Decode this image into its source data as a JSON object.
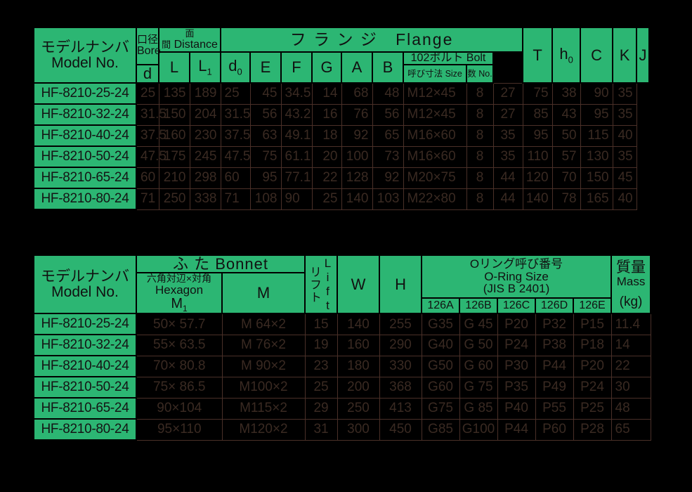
{
  "page": {
    "background": "#000000",
    "header_fill": "#2cb673",
    "header_text": "#111111",
    "data_text": "#3a2a22"
  },
  "table1": {
    "name": "flange-dimension-table",
    "model_header": {
      "line1": "モデルナンバ",
      "line2": "Model No."
    },
    "groups": {
      "bore": {
        "jp": "口径",
        "en": "Bore"
      },
      "distance": {
        "jp": "面間",
        "en": "Distance"
      },
      "flange": {
        "jp": "フ ラ ン ジ",
        "en": "Flange"
      },
      "bolt": {
        "label": "102ボルト Bolt"
      }
    },
    "columns": [
      {
        "key": "d",
        "label": "d"
      },
      {
        "key": "L",
        "label": "L"
      },
      {
        "key": "L1",
        "label": "L",
        "sub": "1"
      },
      {
        "key": "d0",
        "label": "d",
        "sub": "0"
      },
      {
        "key": "E",
        "label": "E"
      },
      {
        "key": "F",
        "label": "F"
      },
      {
        "key": "G",
        "label": "G"
      },
      {
        "key": "A",
        "label": "A"
      },
      {
        "key": "B",
        "label": "B"
      },
      {
        "key": "bolt_size",
        "label": "呼び寸法 Size"
      },
      {
        "key": "bolt_no",
        "label": "数 No."
      },
      {
        "key": "T",
        "label": "T"
      },
      {
        "key": "h0",
        "label": "h",
        "sub": "0"
      },
      {
        "key": "C",
        "label": "C"
      },
      {
        "key": "K",
        "label": "K"
      },
      {
        "key": "J",
        "label": "J"
      }
    ],
    "rows": [
      {
        "model": "HF-8210-25-24",
        "d": "25",
        "L": "135",
        "L1": "189",
        "d0": "25",
        "E": "45",
        "F": "34.5",
        "G": "14",
        "A": "68",
        "B": "48",
        "bolt_size": "M12×45",
        "bolt_no": "8",
        "T": "27",
        "h0": "75",
        "C": "38",
        "K": "90",
        "J": "35"
      },
      {
        "model": "HF-8210-32-24",
        "d": "31.5",
        "L": "150",
        "L1": "204",
        "d0": "31.5",
        "E": "56",
        "F": "43.2",
        "G": "16",
        "A": "76",
        "B": "56",
        "bolt_size": "M12×45",
        "bolt_no": "8",
        "T": "27",
        "h0": "85",
        "C": "43",
        "K": "95",
        "J": "35"
      },
      {
        "model": "HF-8210-40-24",
        "d": "37.5",
        "L": "160",
        "L1": "230",
        "d0": "37.5",
        "E": "63",
        "F": "49.1",
        "G": "18",
        "A": "92",
        "B": "65",
        "bolt_size": "M16×60",
        "bolt_no": "8",
        "T": "35",
        "h0": "95",
        "C": "50",
        "K": "115",
        "J": "40"
      },
      {
        "model": "HF-8210-50-24",
        "d": "47.5",
        "L": "175",
        "L1": "245",
        "d0": "47.5",
        "E": "75",
        "F": "61.1",
        "G": "20",
        "A": "100",
        "B": "73",
        "bolt_size": "M16×60",
        "bolt_no": "8",
        "T": "35",
        "h0": "110",
        "C": "57",
        "K": "130",
        "J": "35"
      },
      {
        "model": "HF-8210-65-24",
        "d": "60",
        "L": "210",
        "L1": "298",
        "d0": "60",
        "E": "95",
        "F": "77.1",
        "G": "22",
        "A": "128",
        "B": "92",
        "bolt_size": "M20×75",
        "bolt_no": "8",
        "T": "44",
        "h0": "120",
        "C": "70",
        "K": "150",
        "J": "45"
      },
      {
        "model": "HF-8210-80-24",
        "d": "71",
        "L": "250",
        "L1": "338",
        "d0": "71",
        "E": "108",
        "F": "90",
        "G": "25",
        "A": "140",
        "B": "103",
        "bolt_size": "M22×80",
        "bolt_no": "8",
        "T": "44",
        "h0": "140",
        "C": "78",
        "K": "165",
        "J": "40"
      }
    ]
  },
  "table2": {
    "name": "bonnet-oring-mass-table",
    "model_header": {
      "line1": "モデルナンバ",
      "line2": "Model No."
    },
    "groups": {
      "bonnet": {
        "label": "ふ た Bonnet"
      },
      "hexagon": {
        "jp": "六角対辺×対角",
        "en": "Hexagon",
        "sym": "M",
        "sub": "1"
      },
      "lift": {
        "jp": "リフト",
        "en": "Lift"
      },
      "oring": {
        "line1": "Oリング呼び番号",
        "line2": "O-Ring Size",
        "line3": "(JIS B 2401)"
      },
      "mass": {
        "jp": "質量",
        "en": "Mass",
        "unit": "(kg)"
      }
    },
    "columns": [
      {
        "key": "m1",
        "label": "M",
        "sub": "1"
      },
      {
        "key": "m",
        "label": "M"
      },
      {
        "key": "lift",
        "label": "Lift"
      },
      {
        "key": "W",
        "label": "W"
      },
      {
        "key": "H",
        "label": "H"
      },
      {
        "key": "o126a",
        "label": "126A"
      },
      {
        "key": "o126b",
        "label": "126B"
      },
      {
        "key": "o126c",
        "label": "126C"
      },
      {
        "key": "o126d",
        "label": "126D"
      },
      {
        "key": "o126e",
        "label": "126E"
      },
      {
        "key": "mass",
        "label": "(kg)"
      }
    ],
    "rows": [
      {
        "model": "HF-8210-25-24",
        "m1": "50×  57.7",
        "m": "M  64×2",
        "lift": "15",
        "W": "140",
        "H": "255",
        "o126a": "G35",
        "o126b": "G  45",
        "o126c": "P20",
        "o126d": "P32",
        "o126e": "P15",
        "mass": "11.4"
      },
      {
        "model": "HF-8210-32-24",
        "m1": "55×  63.5",
        "m": "M  76×2",
        "lift": "19",
        "W": "160",
        "H": "290",
        "o126a": "G40",
        "o126b": "G  50",
        "o126c": "P24",
        "o126d": "P38",
        "o126e": "P18",
        "mass": "14"
      },
      {
        "model": "HF-8210-40-24",
        "m1": "70×  80.8",
        "m": "M  90×2",
        "lift": "23",
        "W": "180",
        "H": "330",
        "o126a": "G50",
        "o126b": "G  60",
        "o126c": "P30",
        "o126d": "P44",
        "o126e": "P20",
        "mass": "22"
      },
      {
        "model": "HF-8210-50-24",
        "m1": "75×  86.5",
        "m": "M100×2",
        "lift": "25",
        "W": "200",
        "H": "368",
        "o126a": "G60",
        "o126b": "G  75",
        "o126c": "P35",
        "o126d": "P49",
        "o126e": "P24",
        "mass": "30"
      },
      {
        "model": "HF-8210-65-24",
        "m1": "90×104",
        "m": "M115×2",
        "lift": "29",
        "W": "250",
        "H": "413",
        "o126a": "G75",
        "o126b": "G  85",
        "o126c": "P40",
        "o126d": "P55",
        "o126e": "P25",
        "mass": "48"
      },
      {
        "model": "HF-8210-80-24",
        "m1": "95×110",
        "m": "M120×2",
        "lift": "31",
        "W": "300",
        "H": "450",
        "o126a": "G85",
        "o126b": "G100",
        "o126c": "P44",
        "o126d": "P60",
        "o126e": "P28",
        "mass": "65"
      }
    ]
  }
}
